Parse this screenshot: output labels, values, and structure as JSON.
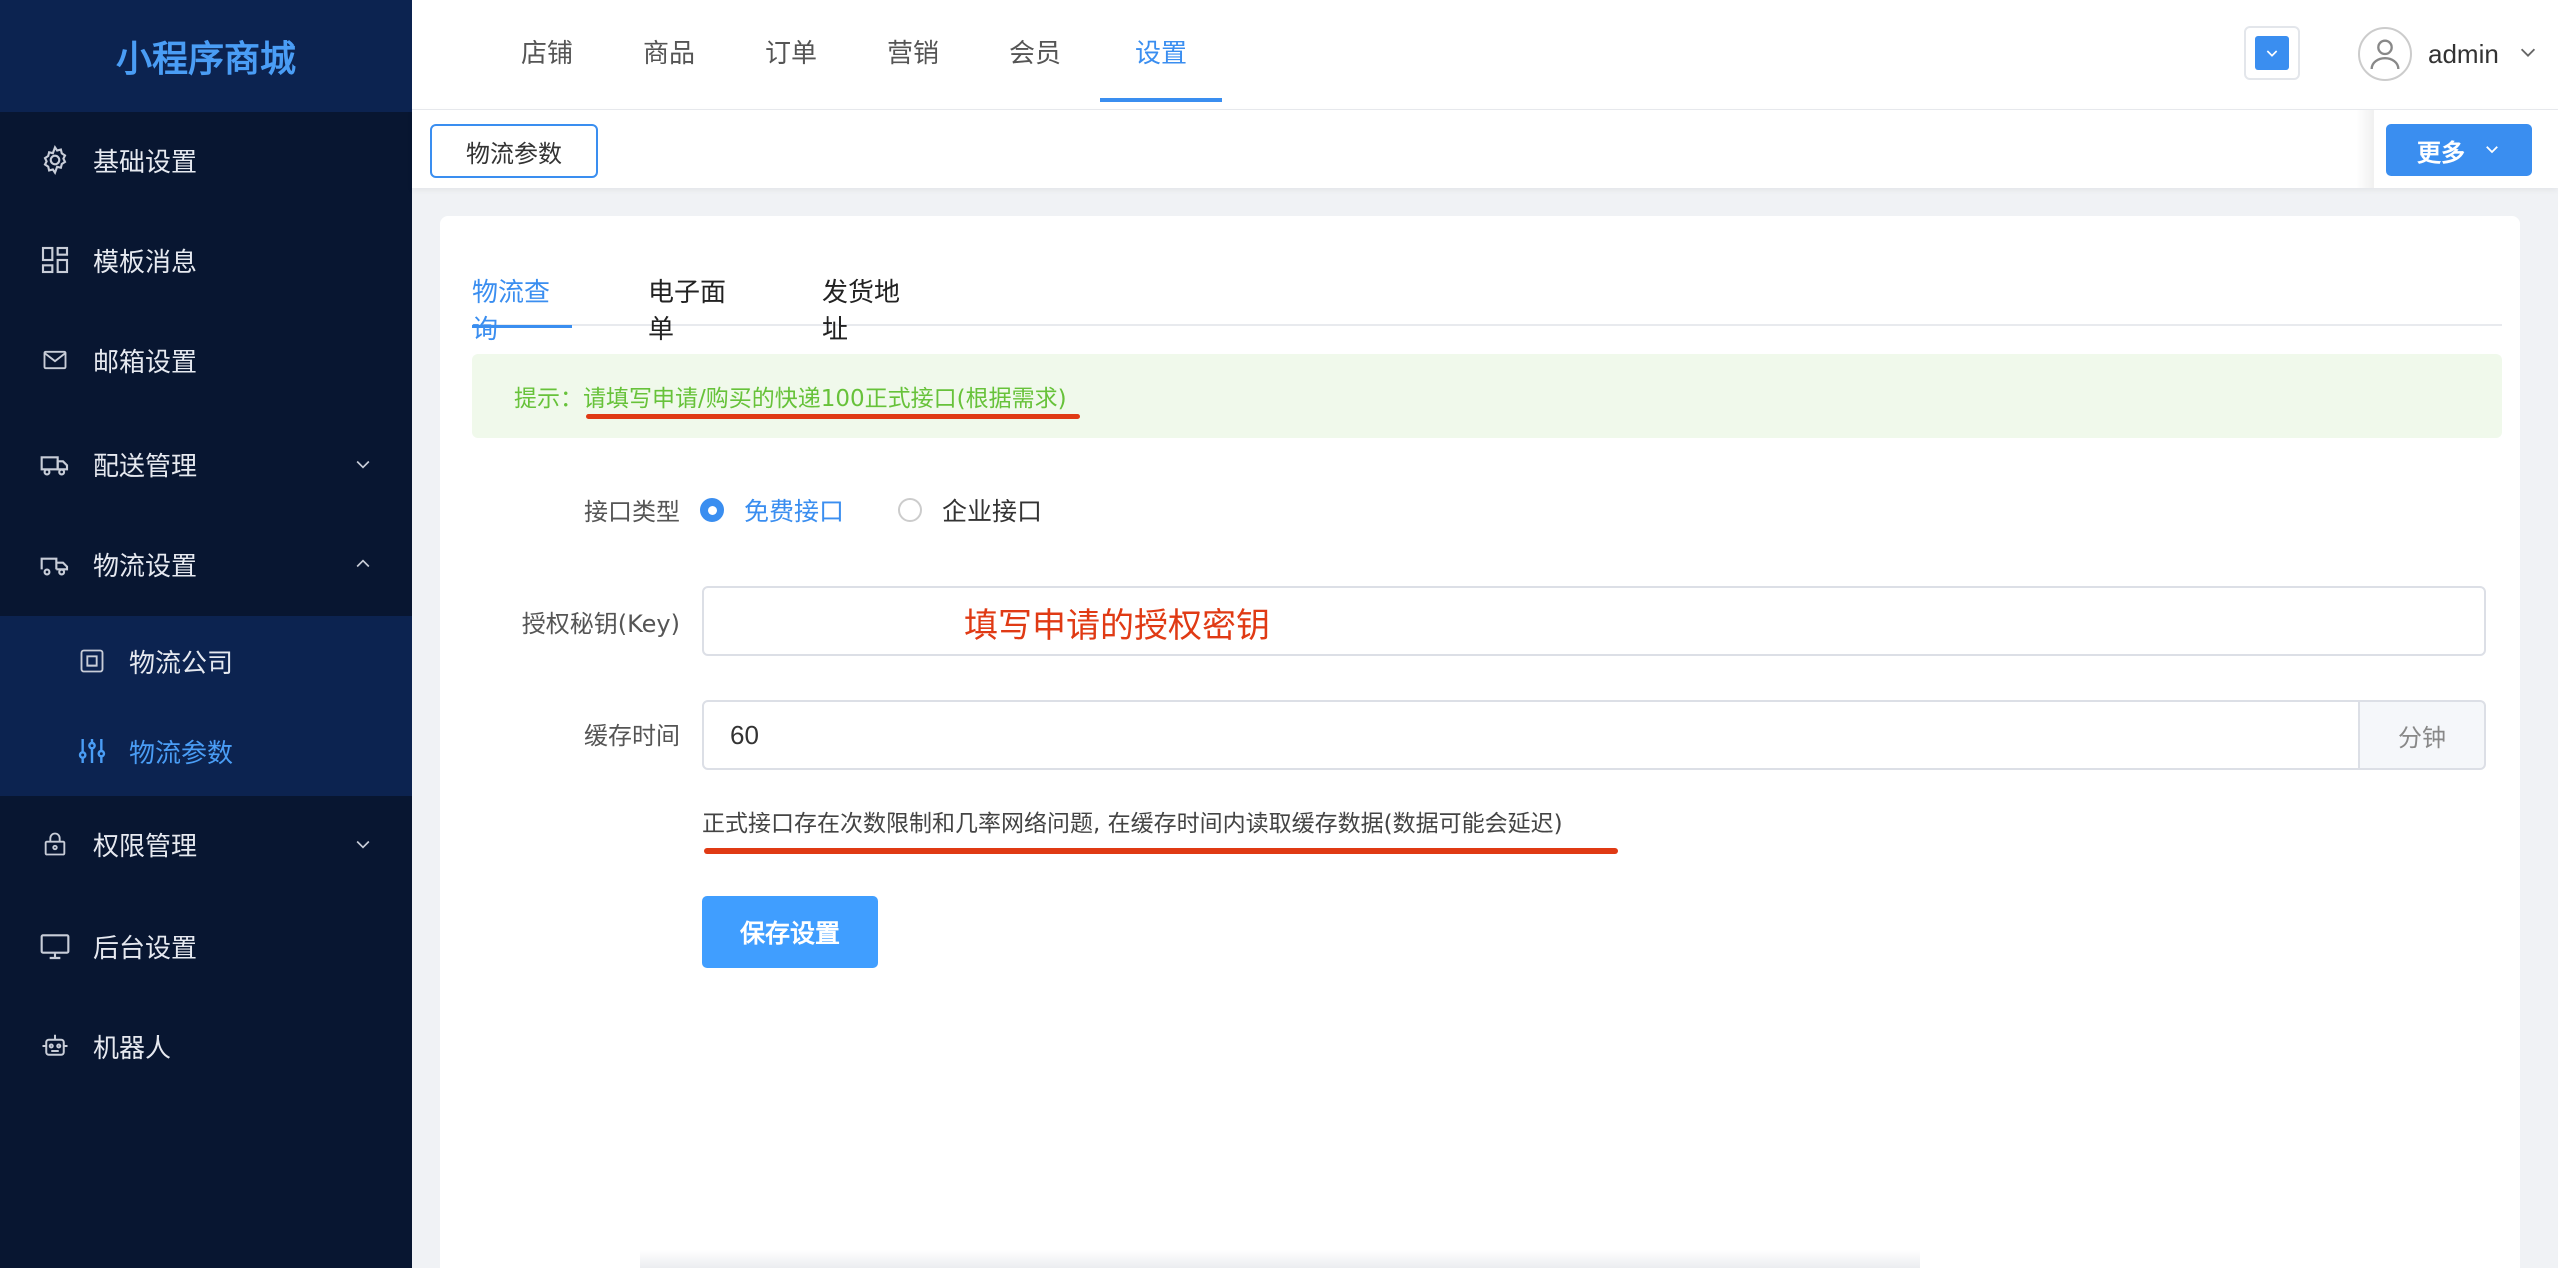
{
  "sidebar": {
    "logo": "小程序商城",
    "items": [
      {
        "label": "基础设置",
        "icon": "gear-icon"
      },
      {
        "label": "模板消息",
        "icon": "grid-icon"
      },
      {
        "label": "邮箱设置",
        "icon": "mail-icon"
      },
      {
        "label": "配送管理",
        "icon": "truck-icon"
      },
      {
        "label": "物流设置",
        "icon": "delivery-icon"
      },
      {
        "label": "权限管理",
        "icon": "lock-icon"
      },
      {
        "label": "后台设置",
        "icon": "monitor-icon"
      },
      {
        "label": "机器人",
        "icon": "robot-icon"
      }
    ],
    "subitems": [
      {
        "label": "物流公司",
        "icon": "company-icon"
      },
      {
        "label": "物流参数",
        "icon": "sliders-icon"
      }
    ]
  },
  "topnav": {
    "tabs": [
      "店铺",
      "商品",
      "订单",
      "营销",
      "会员",
      "设置"
    ],
    "active": "设置",
    "username": "admin"
  },
  "tagbar": {
    "tag": "物流参数",
    "more": "更多"
  },
  "card": {
    "tabs": [
      "物流查询",
      "电子面单",
      "发货地址"
    ],
    "active_tab": "物流查询",
    "alert": {
      "prefix": "提示：",
      "text": "请填写申请/购买的快递100正式接口(根据需求)"
    },
    "form": {
      "api_type_label": "接口类型",
      "api_options": [
        "免费接口",
        "企业接口"
      ],
      "api_selected": "免费接口",
      "key_label": "授权秘钥(Key)",
      "key_value": "",
      "key_annotation": "填写申请的授权密钥",
      "cache_label": "缓存时间",
      "cache_value": "60",
      "cache_unit": "分钟",
      "hint": "正式接口存在次数限制和几率网络问题, 在缓存时间内读取缓存数据(数据可能会延迟)",
      "save": "保存设置"
    }
  },
  "colors": {
    "primary": "#3a8ef0",
    "sidebar_bg": "#081631",
    "annotation_red": "#e03a14",
    "alert_green": "#67c23a"
  }
}
